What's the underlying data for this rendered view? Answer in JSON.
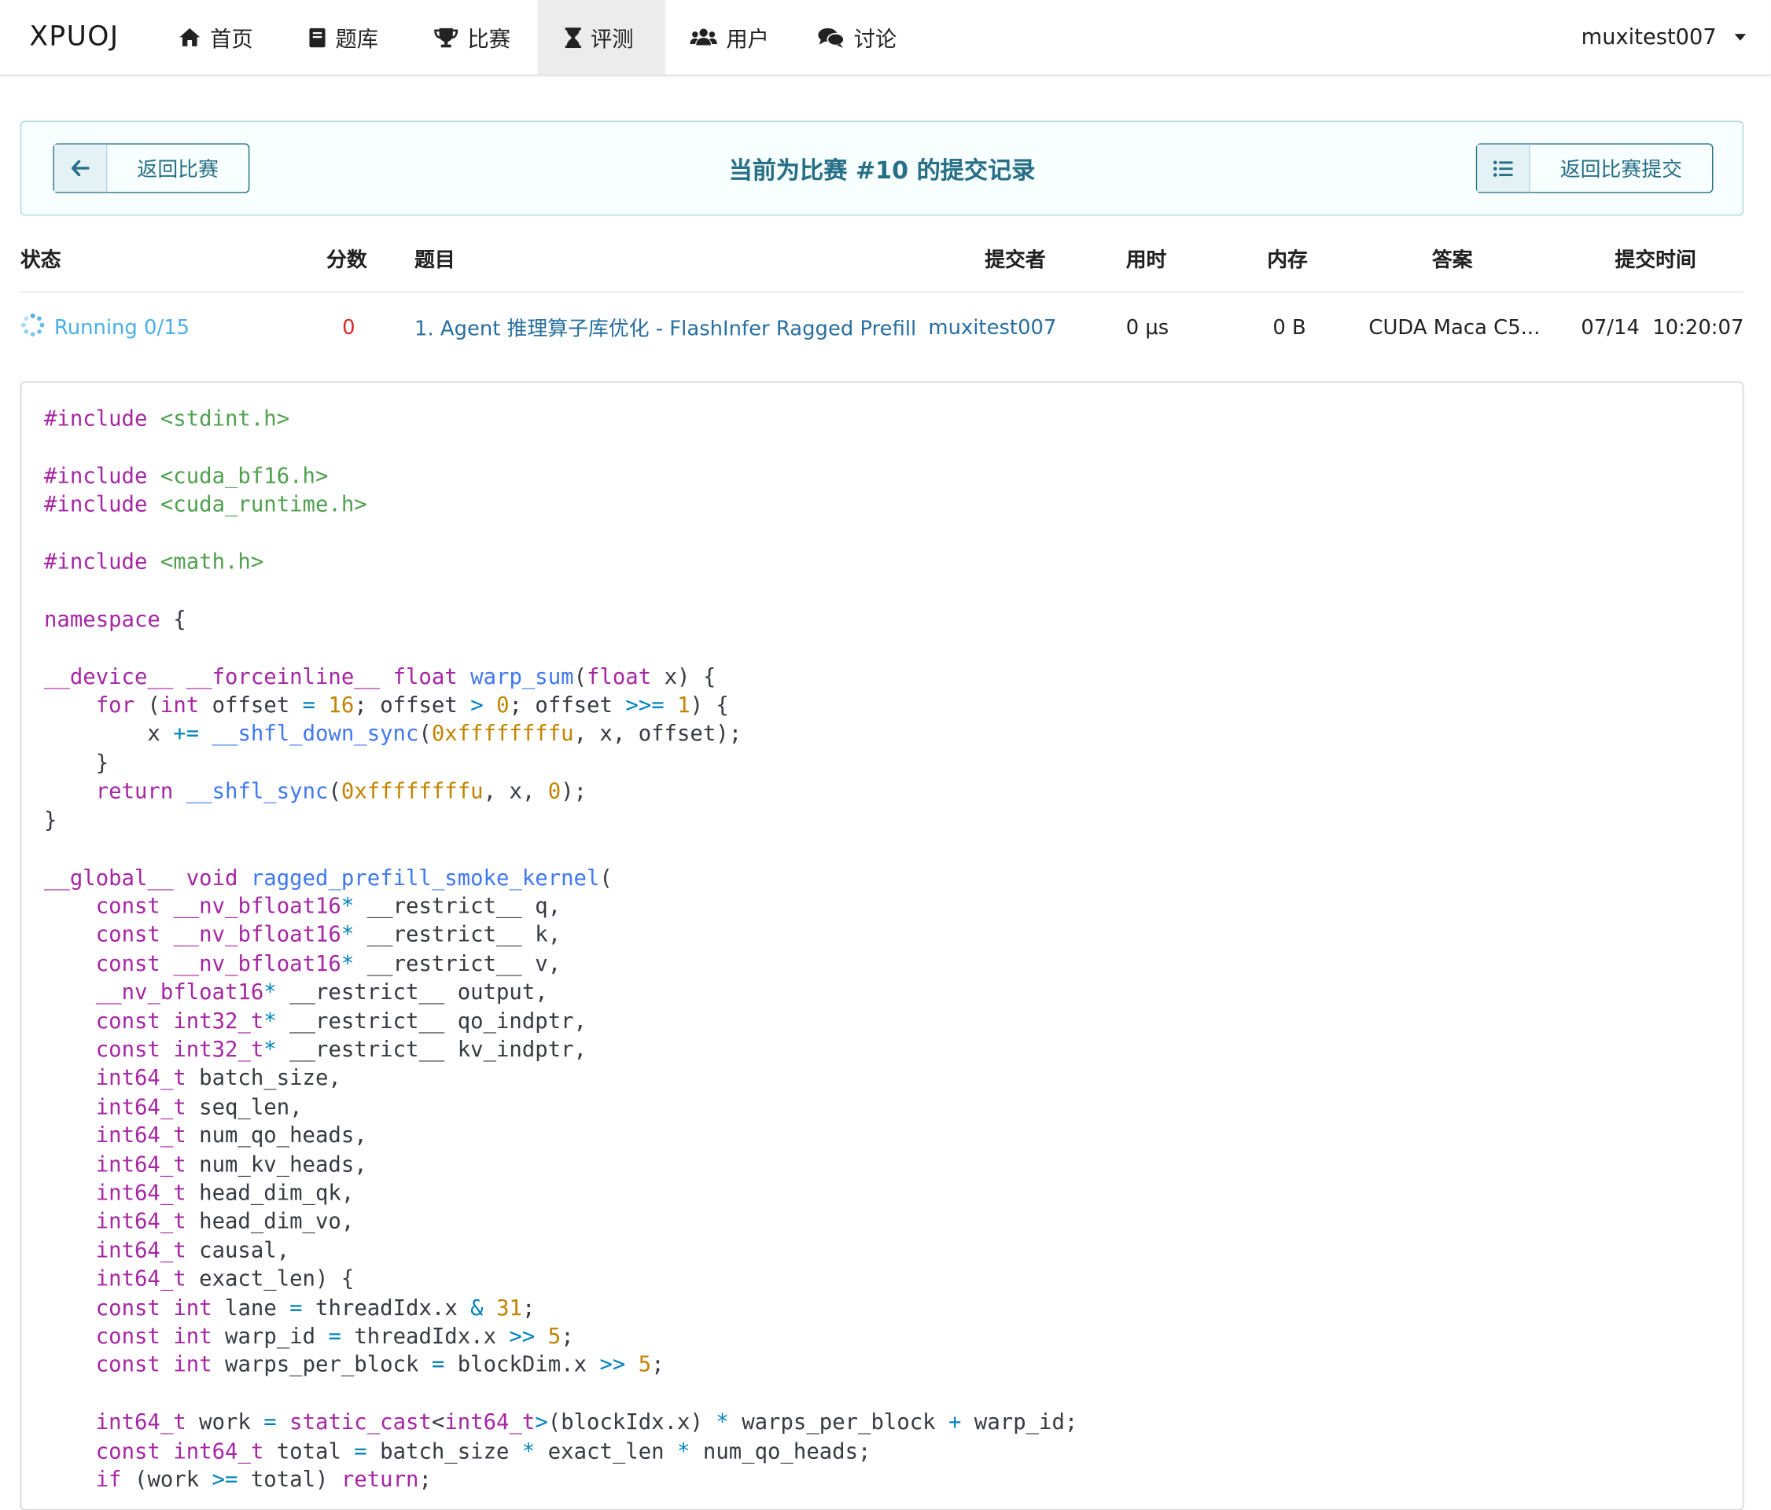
{
  "nav": {
    "brand": "XPUOJ",
    "items": [
      {
        "label": "首页",
        "icon": "home-icon"
      },
      {
        "label": "题库",
        "icon": "book-icon"
      },
      {
        "label": "比赛",
        "icon": "trophy-icon"
      },
      {
        "label": "评测",
        "icon": "hourglass-icon",
        "active": true
      },
      {
        "label": "用户",
        "icon": "users-icon"
      },
      {
        "label": "讨论",
        "icon": "comments-icon"
      }
    ],
    "user": "muxitest007"
  },
  "banner": {
    "back_label": "返回比赛",
    "title": "当前为比赛 #10 的提交记录",
    "submissions_label": "返回比赛提交"
  },
  "table": {
    "headers": {
      "status": "状态",
      "score": "分数",
      "problem": "题目",
      "submitter": "提交者",
      "time": "用时",
      "memory": "内存",
      "answer": "答案",
      "submit_time": "提交时间"
    },
    "row": {
      "status": "Running 0/15",
      "score": "0",
      "problem": "1. Agent 推理算子库优化 - FlashInfer Ragged Prefill",
      "submitter": "muxitest007",
      "time": "0 μs",
      "memory": "0 B",
      "answer": "CUDA Maca C5...",
      "submit_time": "07/14  10:20:07"
    }
  },
  "colors": {
    "accent": "#276f86",
    "running": "#4ab0e6",
    "score": "#db2828",
    "link": "#276f9e"
  },
  "code": [
    "#include <stdint.h>",
    "",
    "#include <cuda_bf16.h>",
    "#include <cuda_runtime.h>",
    "",
    "#include <math.h>",
    "",
    "namespace {",
    "",
    "__device__ __forceinline__ float warp_sum(float x) {",
    "    for (int offset = 16; offset > 0; offset >>= 1) {",
    "        x += __shfl_down_sync(0xffffffffu, x, offset);",
    "    }",
    "    return __shfl_sync(0xffffffffu, x, 0);",
    "}",
    "",
    "__global__ void ragged_prefill_smoke_kernel(",
    "    const __nv_bfloat16* __restrict__ q,",
    "    const __nv_bfloat16* __restrict__ k,",
    "    const __nv_bfloat16* __restrict__ v,",
    "    __nv_bfloat16* __restrict__ output,",
    "    const int32_t* __restrict__ qo_indptr,",
    "    const int32_t* __restrict__ kv_indptr,",
    "    int64_t batch_size,",
    "    int64_t seq_len,",
    "    int64_t num_qo_heads,",
    "    int64_t num_kv_heads,",
    "    int64_t head_dim_qk,",
    "    int64_t head_dim_vo,",
    "    int64_t causal,",
    "    int64_t exact_len) {",
    "    const int lane = threadIdx.x & 31;",
    "    const int warp_id = threadIdx.x >> 5;",
    "    const int warps_per_block = blockDim.x >> 5;",
    "",
    "    int64_t work = static_cast<int64_t>(blockIdx.x) * warps_per_block + warp_id;",
    "    const int64_t total = batch_size * exact_len * num_qo_heads;",
    "    if (work >= total) return;"
  ]
}
